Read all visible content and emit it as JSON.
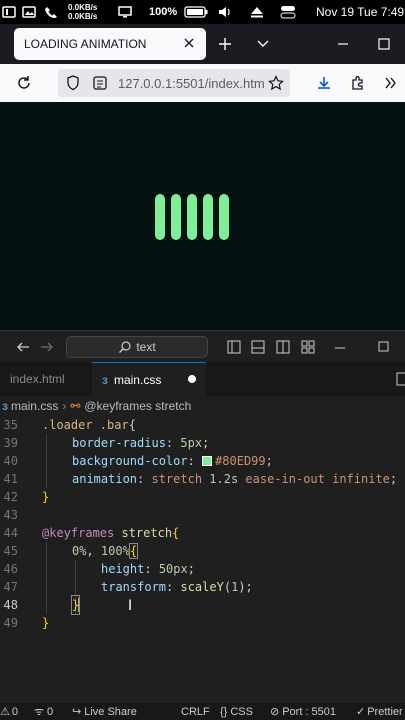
{
  "phone_status": {
    "net_up": "0.0KB/s",
    "net_down": "0.0KB/s",
    "battery": "100%",
    "datetime": "Nov 19 Tue 7:49"
  },
  "browser": {
    "tab_title": "LOADING ANIMATION",
    "url": "127.0.0.1:5501/index.htm"
  },
  "page": {
    "background": "#041212",
    "bar_color": "#80ED99",
    "bar_count": 5
  },
  "vscode": {
    "command_center": "text",
    "tabs": [
      {
        "label": "index.html"
      },
      {
        "label": "main.css"
      }
    ],
    "breadcrumb": {
      "file": "main.css",
      "symbol": "@keyframes stretch"
    },
    "lines": [
      {
        "n": "35",
        "text": ".loader .bar{"
      },
      {
        "n": "39",
        "text": "border-radius: 5px;"
      },
      {
        "n": "40",
        "text": "background-color: #80ED99;"
      },
      {
        "n": "41",
        "text": "animation: stretch 1.2s ease-in-out infinite;"
      },
      {
        "n": "42",
        "text": "}"
      },
      {
        "n": "43",
        "text": ""
      },
      {
        "n": "44",
        "text": "@keyframes stretch{"
      },
      {
        "n": "45",
        "text": "0%, 100%{"
      },
      {
        "n": "46",
        "text": "height: 50px;"
      },
      {
        "n": "47",
        "text": "transform: scaleY(1);"
      },
      {
        "n": "48",
        "text": "}"
      },
      {
        "n": "49",
        "text": "}"
      }
    ],
    "status": {
      "errors": "0",
      "warnings": "0",
      "ports": "0",
      "live_share": "Live Share",
      "eol": "CRLF",
      "language": "CSS",
      "port": "Port : 5501",
      "prettier": "Prettier"
    }
  }
}
